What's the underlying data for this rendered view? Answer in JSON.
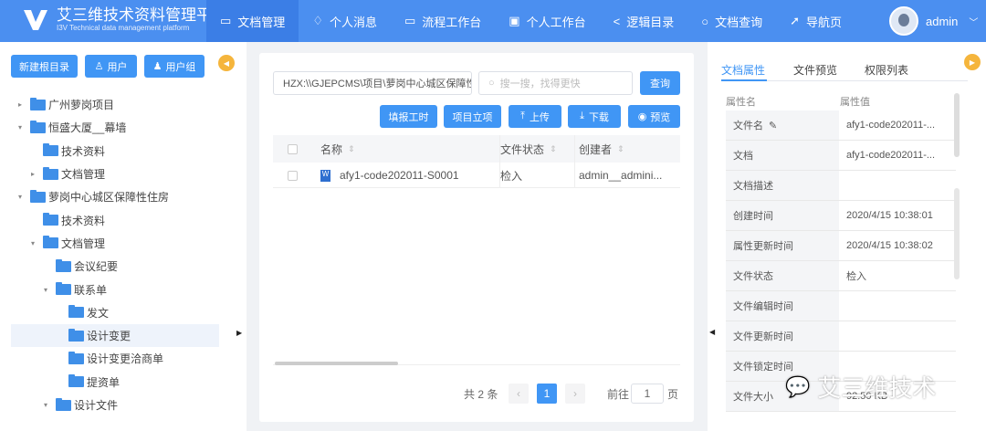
{
  "header": {
    "title": "艾三维技术资料管理平台",
    "subtitle": "I3V Technical data management platform",
    "nav": [
      {
        "label": "文档管理",
        "icon": "folder-icon",
        "active": true
      },
      {
        "label": "个人消息",
        "icon": "bell-icon"
      },
      {
        "label": "流程工作台",
        "icon": "monitor-icon"
      },
      {
        "label": "个人工作台",
        "icon": "briefcase-icon"
      },
      {
        "label": "逻辑目录",
        "icon": "share-icon"
      },
      {
        "label": "文档查询",
        "icon": "search-icon"
      },
      {
        "label": "导航页",
        "icon": "navigation-icon"
      }
    ],
    "user": "admin"
  },
  "left": {
    "buttons": [
      "新建根目录",
      "用户",
      "用户组"
    ],
    "tree": [
      {
        "label": "广州萝岗项目",
        "level": 0,
        "arrow": "right"
      },
      {
        "label": "恒盛大厦__幕墙",
        "level": 0,
        "arrow": "down"
      },
      {
        "label": "技术资料",
        "level": 1,
        "arrow": ""
      },
      {
        "label": "文档管理",
        "level": 1,
        "arrow": "right"
      },
      {
        "label": "萝岗中心城区保障性住房",
        "level": 0,
        "arrow": "down"
      },
      {
        "label": "技术资料",
        "level": 1,
        "arrow": ""
      },
      {
        "label": "文档管理",
        "level": 1,
        "arrow": "down"
      },
      {
        "label": "会议纪要",
        "level": 2,
        "arrow": ""
      },
      {
        "label": "联系单",
        "level": 2,
        "arrow": "down"
      },
      {
        "label": "发文",
        "level": 3,
        "arrow": ""
      },
      {
        "label": "设计变更",
        "level": 3,
        "arrow": "",
        "selected": true
      },
      {
        "label": "设计变更洽商单",
        "level": 3,
        "arrow": ""
      },
      {
        "label": "提资单",
        "level": 3,
        "arrow": ""
      },
      {
        "label": "设计文件",
        "level": 2,
        "arrow": "down"
      }
    ]
  },
  "main": {
    "path": "HZX:\\\\GJEPCMS\\项目\\萝岗中心城区保障性",
    "search_placeholder": "搜一搜，找得更快",
    "query": "查询",
    "actions": [
      "填报工时",
      "项目立项",
      "上传",
      "下载",
      "预览"
    ],
    "columns": [
      "名称",
      "文件状态",
      "创建者"
    ],
    "rows": [
      {
        "name": "afy1-code202011-S0001",
        "status": "检入",
        "creator": "admin__admini..."
      }
    ],
    "pagination": {
      "total": "共 2 条",
      "current": "1",
      "goto": "前往",
      "page": "1",
      "unit": "页"
    }
  },
  "right": {
    "tabs": [
      "文档属性",
      "文件预览",
      "权限列表"
    ],
    "headers": [
      "属性名",
      "属性值"
    ],
    "props": [
      {
        "k": "文件名",
        "v": "afy1-code202011-...",
        "edit": true
      },
      {
        "k": "文档",
        "v": "afy1-code202011-..."
      },
      {
        "k": "文档描述",
        "v": ""
      },
      {
        "k": "创建时间",
        "v": "2020/4/15 10:38:01"
      },
      {
        "k": "属性更新时间",
        "v": "2020/4/15 10:38:02"
      },
      {
        "k": "文件状态",
        "v": "检入"
      },
      {
        "k": "文件编辑时间",
        "v": ""
      },
      {
        "k": "文件更新时间",
        "v": ""
      },
      {
        "k": "文件锁定时间",
        "v": ""
      },
      {
        "k": "文件大小",
        "v": "92.50 KB"
      }
    ]
  },
  "watermark": "艾三维技术"
}
